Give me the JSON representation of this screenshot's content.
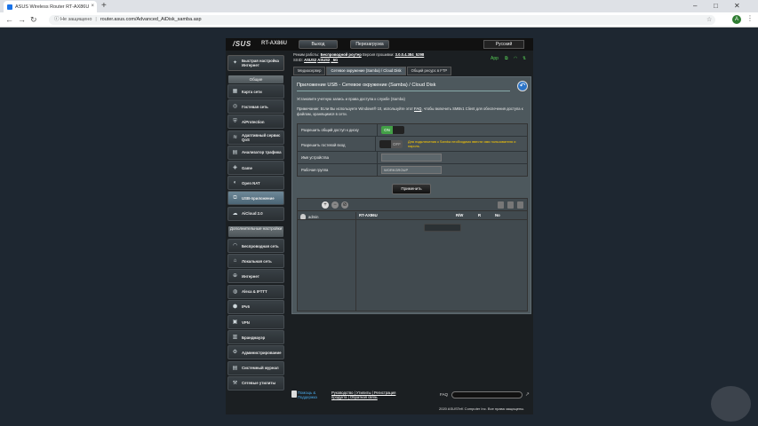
{
  "browser": {
    "tab_title": "ASUS Wireless Router RT-AX86U",
    "tab_close": "×",
    "newtab": "+",
    "win_min": "–",
    "win_max": "□",
    "win_close": "✕",
    "security": "Не защищено",
    "url": "router.asus.com/Advanced_AiDisk_samba.asp",
    "avatar": "A"
  },
  "header": {
    "logo": "/SUS",
    "model": "RT-AX86U",
    "logout": "Выход",
    "reboot": "Перезагрузка",
    "language": "Русский"
  },
  "info": {
    "mode_label": "Режим работы:",
    "mode_value": "Беспроводной роутер",
    "fw_label": "Версия прошивки:",
    "fw_value": "3.0.0.4.384_5298",
    "ssid_label": "SSID:",
    "ssid1": "ASUS2",
    "ssid2": "ASUS2",
    "ssid3": "_5G",
    "app_label": "App"
  },
  "sidebar": {
    "quick": "Быстрая настройка Интернет",
    "general": "Общие",
    "advanced": "Дополнительные настройки",
    "general_items": [
      {
        "label": "Карта сети",
        "icon": "▦"
      },
      {
        "label": "Гостевая сеть",
        "icon": "◎"
      },
      {
        "label": "AiProtection",
        "icon": "⛨"
      },
      {
        "label": "Адаптивный сервис QoS",
        "icon": "≋"
      },
      {
        "label": "Анализатор трафика",
        "icon": "▤"
      },
      {
        "label": "Game",
        "icon": "◈"
      },
      {
        "label": "Open NAT",
        "icon": "◐"
      },
      {
        "label": "USB-приложение",
        "icon": "⧉"
      },
      {
        "label": "AiCloud 2.0",
        "icon": "☁"
      }
    ],
    "advanced_items": [
      {
        "label": "Беспроводная сеть",
        "icon": "◠"
      },
      {
        "label": "Локальная сеть",
        "icon": "⌂"
      },
      {
        "label": "Интернет",
        "icon": "⊕"
      },
      {
        "label": "Alexa & IFTTT",
        "icon": "◍"
      },
      {
        "label": "IPv6",
        "icon": "⬢"
      },
      {
        "label": "VPN",
        "icon": "▣"
      },
      {
        "label": "Брандмауэр",
        "icon": "▥"
      },
      {
        "label": "Администрирование",
        "icon": "⚙"
      },
      {
        "label": "Системный журнал",
        "icon": "▤"
      },
      {
        "label": "Сетевые утилиты",
        "icon": "⚒"
      }
    ]
  },
  "tabs": [
    "Медиасервер",
    "Сетевое окружение (Samba) / Cloud Disk",
    "Общий ресурс в FTP"
  ],
  "panel": {
    "title": "Приложение USB - Сетевое окружение (Samba) / Cloud Disk",
    "desc1": "Установите учетную запись и права доступа к службе (Samba)",
    "desc2_pre": "Примечание: Если Вы используете Windows® 10, используйте этот",
    "desc2_link": "FAQ",
    "desc2_post": ", чтобы включить SMBv1 Client для обеспечения доступа к файлам, хранящимся в сети.",
    "rows": {
      "share_label": "Разрешить общий доступ к диску",
      "share_state": "ON",
      "guest_label": "Разрешить гостевой вход",
      "guest_state": "OFF",
      "guest_note": "Для подключения к Samba необходимо ввести имя пользователя и пароль.",
      "device_label": "Имя устройства",
      "device_value": "",
      "workgroup_label": "Рабочая группа",
      "workgroup_value": "WORKGROUP"
    },
    "apply": "Применить",
    "share": {
      "plus": "+",
      "minus": "−",
      "edit": "⊘",
      "user": "admin",
      "col_name": "RT-AX86U",
      "col_rw": "R/W",
      "col_r": "R",
      "col_no": "No"
    }
  },
  "footer": {
    "help": "Помощь & Поддержка",
    "links1": "Руководство | Утилиты | Регистрация",
    "links2": "продукта | Обратная связь",
    "faq": "FAQ",
    "go": "↗",
    "copyright": "2020 ASUSTeK Computer Inc. Все права защищены."
  }
}
